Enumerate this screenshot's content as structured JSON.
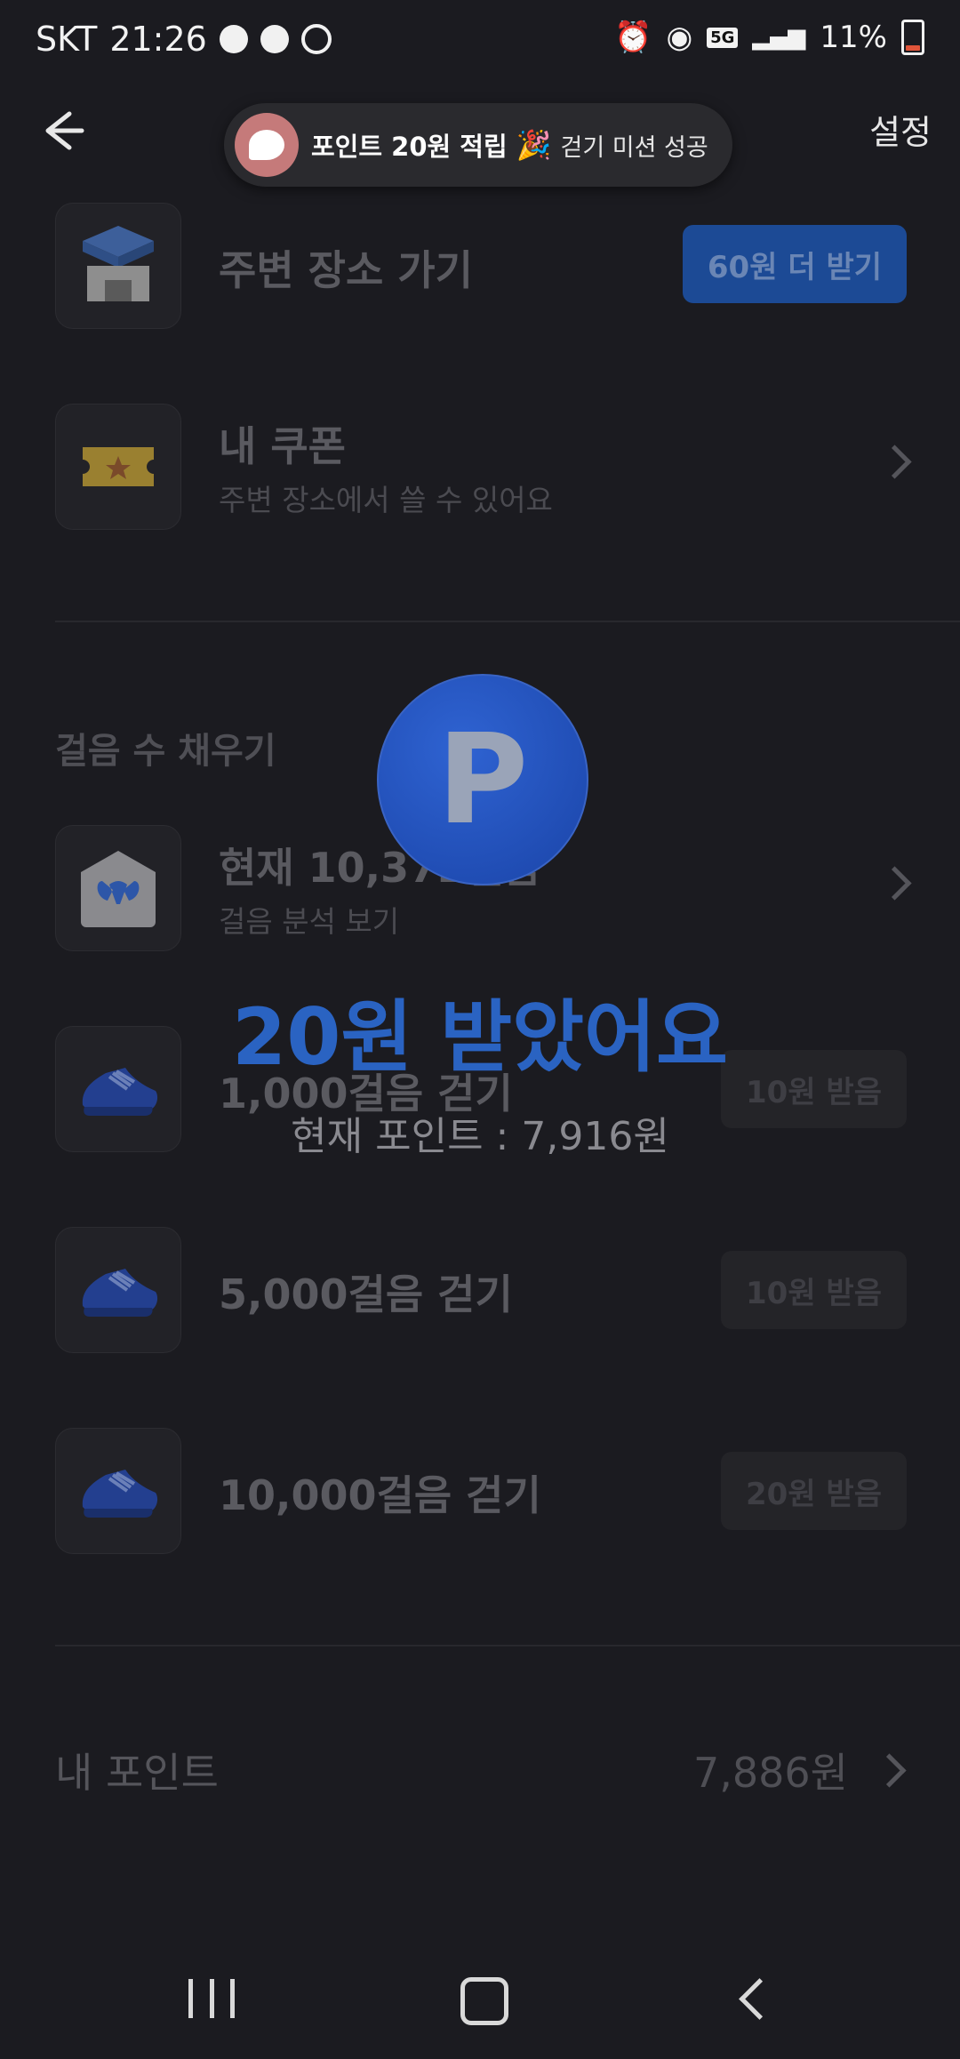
{
  "status_bar": {
    "carrier": "SKT",
    "time": "21:26",
    "network": "5G",
    "battery": "11%"
  },
  "header": {
    "settings_label": "설정"
  },
  "toast": {
    "title": "포인트 20원 적립",
    "message": "걷기 미션 성공"
  },
  "nearby": {
    "title": "주변 장소 가기",
    "button_label": "60원 더 받기"
  },
  "coupons": {
    "title": "내 쿠폰",
    "subtitle": "주변 장소에서 쓸 수 있어요"
  },
  "steps_section": {
    "title": "걸음 수 채우기",
    "current": {
      "title": "현재 10,372걸음",
      "subtitle": "걸음 분석 보기"
    },
    "missions": [
      {
        "title": "1,000걸음 걷기",
        "button": "10원 받음"
      },
      {
        "title": "5,000걸음 걷기",
        "button": "10원 받음"
      },
      {
        "title": "10,000걸음 걷기",
        "button": "20원 받음"
      }
    ]
  },
  "reward_overlay": {
    "coin_letter": "P",
    "title": "20원 받았어요",
    "current_points": "현재 포인트 : 7,916원"
  },
  "my_points": {
    "label": "내 포인트",
    "value": "7,886원"
  },
  "colors": {
    "background": "#1b1b20",
    "accent_blue": "#2a63c2",
    "pill_blue": "#1c4a95"
  }
}
